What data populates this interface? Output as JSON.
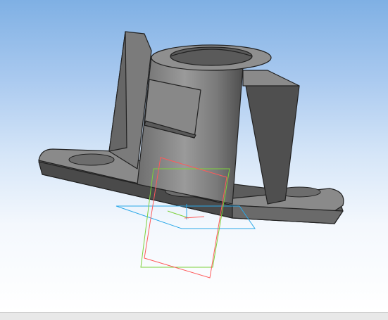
{
  "viewport": {
    "background_top": "#7fb0e4",
    "background_bottom": "#ffffff"
  },
  "model": {
    "body_color": "#7a7a7a",
    "edge_color": "#222222"
  },
  "planes": {
    "red": "#ff5a5a",
    "green": "#7cd13a",
    "blue": "#2aa8e8"
  }
}
